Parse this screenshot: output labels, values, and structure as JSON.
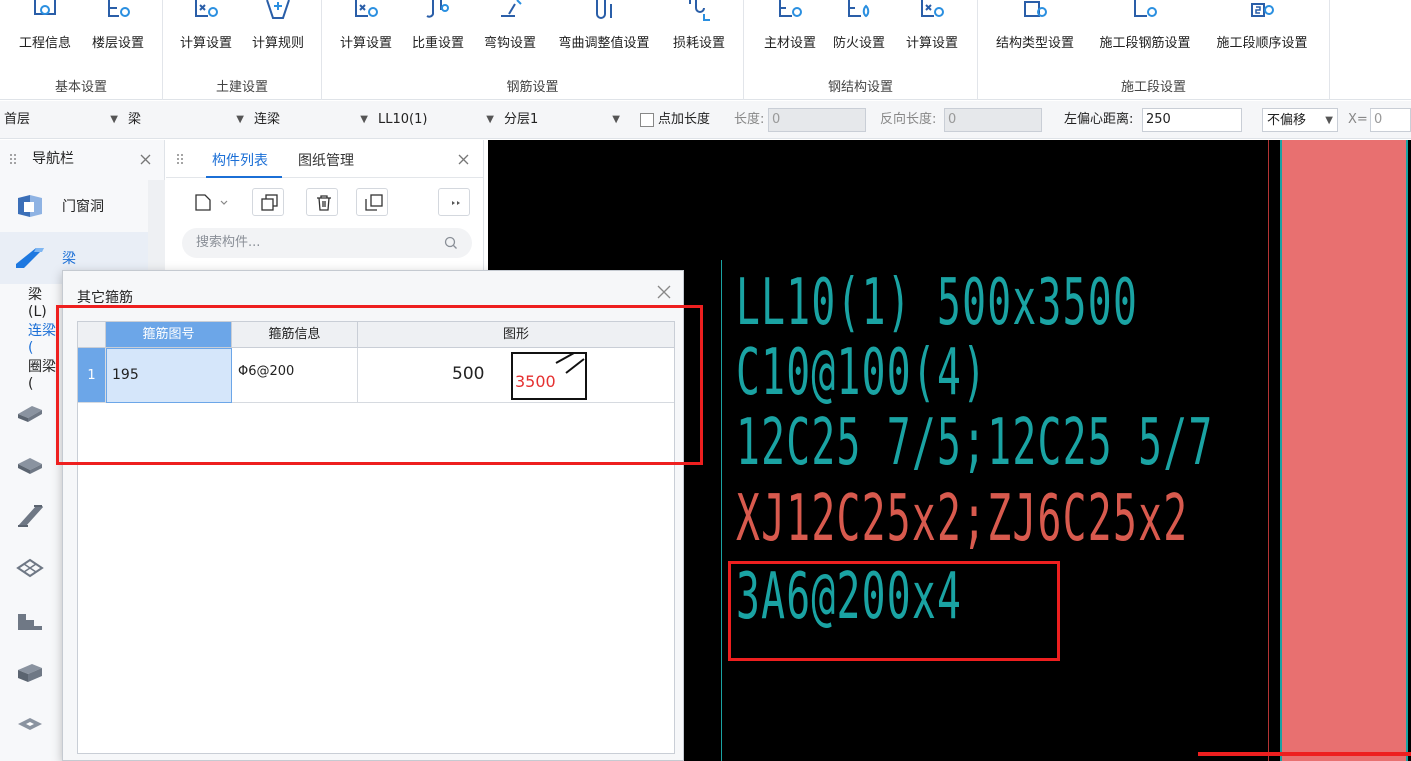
{
  "ribbon": {
    "groups": [
      {
        "title": "基本设置",
        "buttons": [
          "工程信息",
          "楼层设置"
        ]
      },
      {
        "title": "土建设置",
        "buttons": [
          "计算设置",
          "计算规则"
        ]
      },
      {
        "title": "钢筋设置",
        "buttons": [
          "计算设置",
          "比重设置",
          "弯钩设置",
          "弯曲调整值设置",
          "损耗设置"
        ]
      },
      {
        "title": "钢结构设置",
        "buttons": [
          "主材设置",
          "防火设置",
          "计算设置"
        ]
      },
      {
        "title": "施工段设置",
        "buttons": [
          "结构类型设置",
          "施工段钢筋设置",
          "施工段顺序设置"
        ]
      }
    ]
  },
  "propbar": {
    "floor": "首层",
    "category": "梁",
    "type": "连梁",
    "component": "LL10(1)",
    "layer": "分层1",
    "add_length_label": "点加长度",
    "length_label": "长度:",
    "length_value": "0",
    "reverse_length_label": "反向长度:",
    "reverse_length_value": "0",
    "offset_label": "左偏心距离:",
    "offset_value": "250",
    "offset_mode": "不偏移",
    "x_label": "X=",
    "x_value": "0"
  },
  "nav": {
    "title": "导航栏",
    "items": [
      {
        "label": "门窗洞",
        "icon": "door-window-icon"
      },
      {
        "label": "梁",
        "icon": "beam-icon",
        "active": true
      },
      {
        "label": "",
        "icon": "slab-icon"
      },
      {
        "label": "",
        "icon": "stair-icon"
      },
      {
        "label": "",
        "icon": "steel-beam-icon"
      },
      {
        "label": "",
        "icon": "grid-mesh-icon"
      },
      {
        "label": "",
        "icon": "step-icon"
      },
      {
        "label": "",
        "icon": "foundation-icon"
      },
      {
        "label": "",
        "icon": "pile-cap-icon"
      }
    ],
    "sub_items": [
      "梁(L)",
      "连梁(",
      "圈梁("
    ]
  },
  "complist": {
    "tabs": [
      "构件列表",
      "图纸管理"
    ],
    "search_placeholder": "搜索构件..."
  },
  "dialog": {
    "title": "其它箍筋",
    "columns": [
      "箍筋图号",
      "箍筋信息",
      "图形"
    ],
    "rows": [
      {
        "num": "1",
        "code": "195",
        "info": "Φ6@200",
        "shape_left": "500",
        "shape_right": "3500"
      }
    ]
  },
  "canvas": {
    "lines": [
      {
        "text": "LL10(1) 500x3500",
        "color": "#1aa3a3"
      },
      {
        "text": "C10@100(4)",
        "color": "#1aa3a3"
      },
      {
        "text": "12C25 7/5;12C25 5/7",
        "color": "#1aa3a3"
      },
      {
        "text": "XJ12C25x2;ZJ6C25x2",
        "color": "#d85a4e"
      },
      {
        "text": "3A6@200x4",
        "color": "#1aa3a3"
      }
    ]
  },
  "colors": {
    "accent": "#1b6fd6",
    "selected_header": "#6ca6e8",
    "annotation_red": "#ee1f1f",
    "wall_fill": "#e87070"
  }
}
